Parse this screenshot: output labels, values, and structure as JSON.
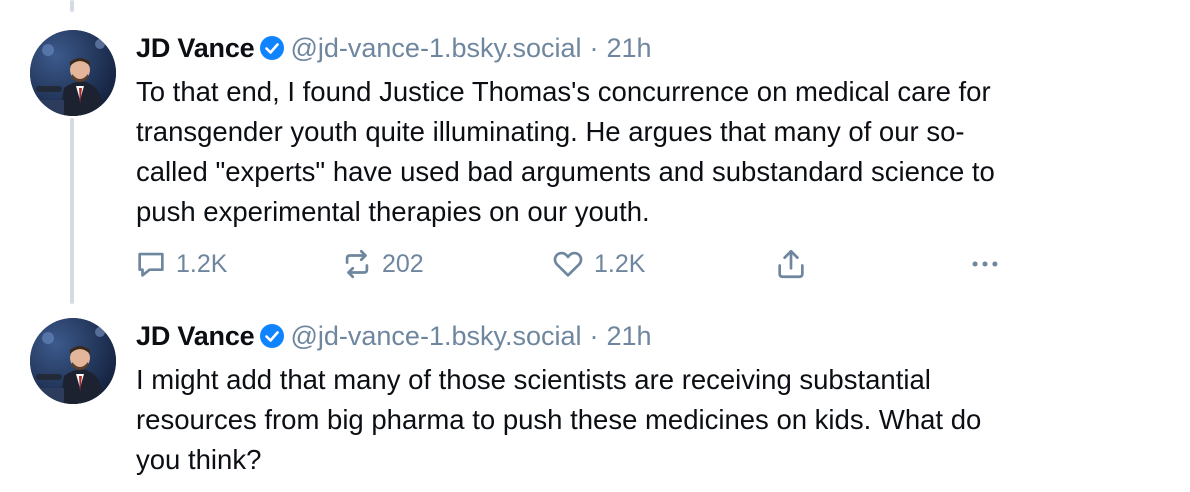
{
  "posts": [
    {
      "author": "JD Vance",
      "handle": "@jd-vance-1.bsky.social",
      "separator": "·",
      "time": "21h",
      "text": "To that end, I found Justice Thomas's concurrence on medical care for transgender youth quite illuminating. He argues that many of our so-called \"experts\" have used bad arguments and substandard science to push experimental therapies on our youth.",
      "line1": "To that end, I found Justice Thomas's concurrence on medical care for",
      "line2": "transgender youth quite illuminating. He argues that many of our so-",
      "line3": "called \"experts\" have used bad arguments and substandard science to",
      "line4": "push experimental therapies on our youth.",
      "replies": "1.2K",
      "reposts": "202",
      "likes": "1.2K"
    },
    {
      "author": "JD Vance",
      "handle": "@jd-vance-1.bsky.social",
      "separator": "·",
      "time": "21h",
      "text": "I might add that many of those scientists are receiving substantial resources from big pharma to push these medicines on kids. What do you think?",
      "line1": "I might add that many of those scientists are receiving substantial",
      "line2": "resources from big pharma to push these medicines on kids. What do",
      "line3": "you think?"
    }
  ],
  "icons": {
    "verified": "verified-badge-icon",
    "reply": "speech-bubble-icon",
    "repost": "repost-arrows-icon",
    "like": "heart-icon",
    "share": "share-upload-icon",
    "more": "ellipsis-icon"
  },
  "colors": {
    "verified": "#1083fe",
    "muted": "#6f869f",
    "thread_line": "#d4dbe2"
  }
}
